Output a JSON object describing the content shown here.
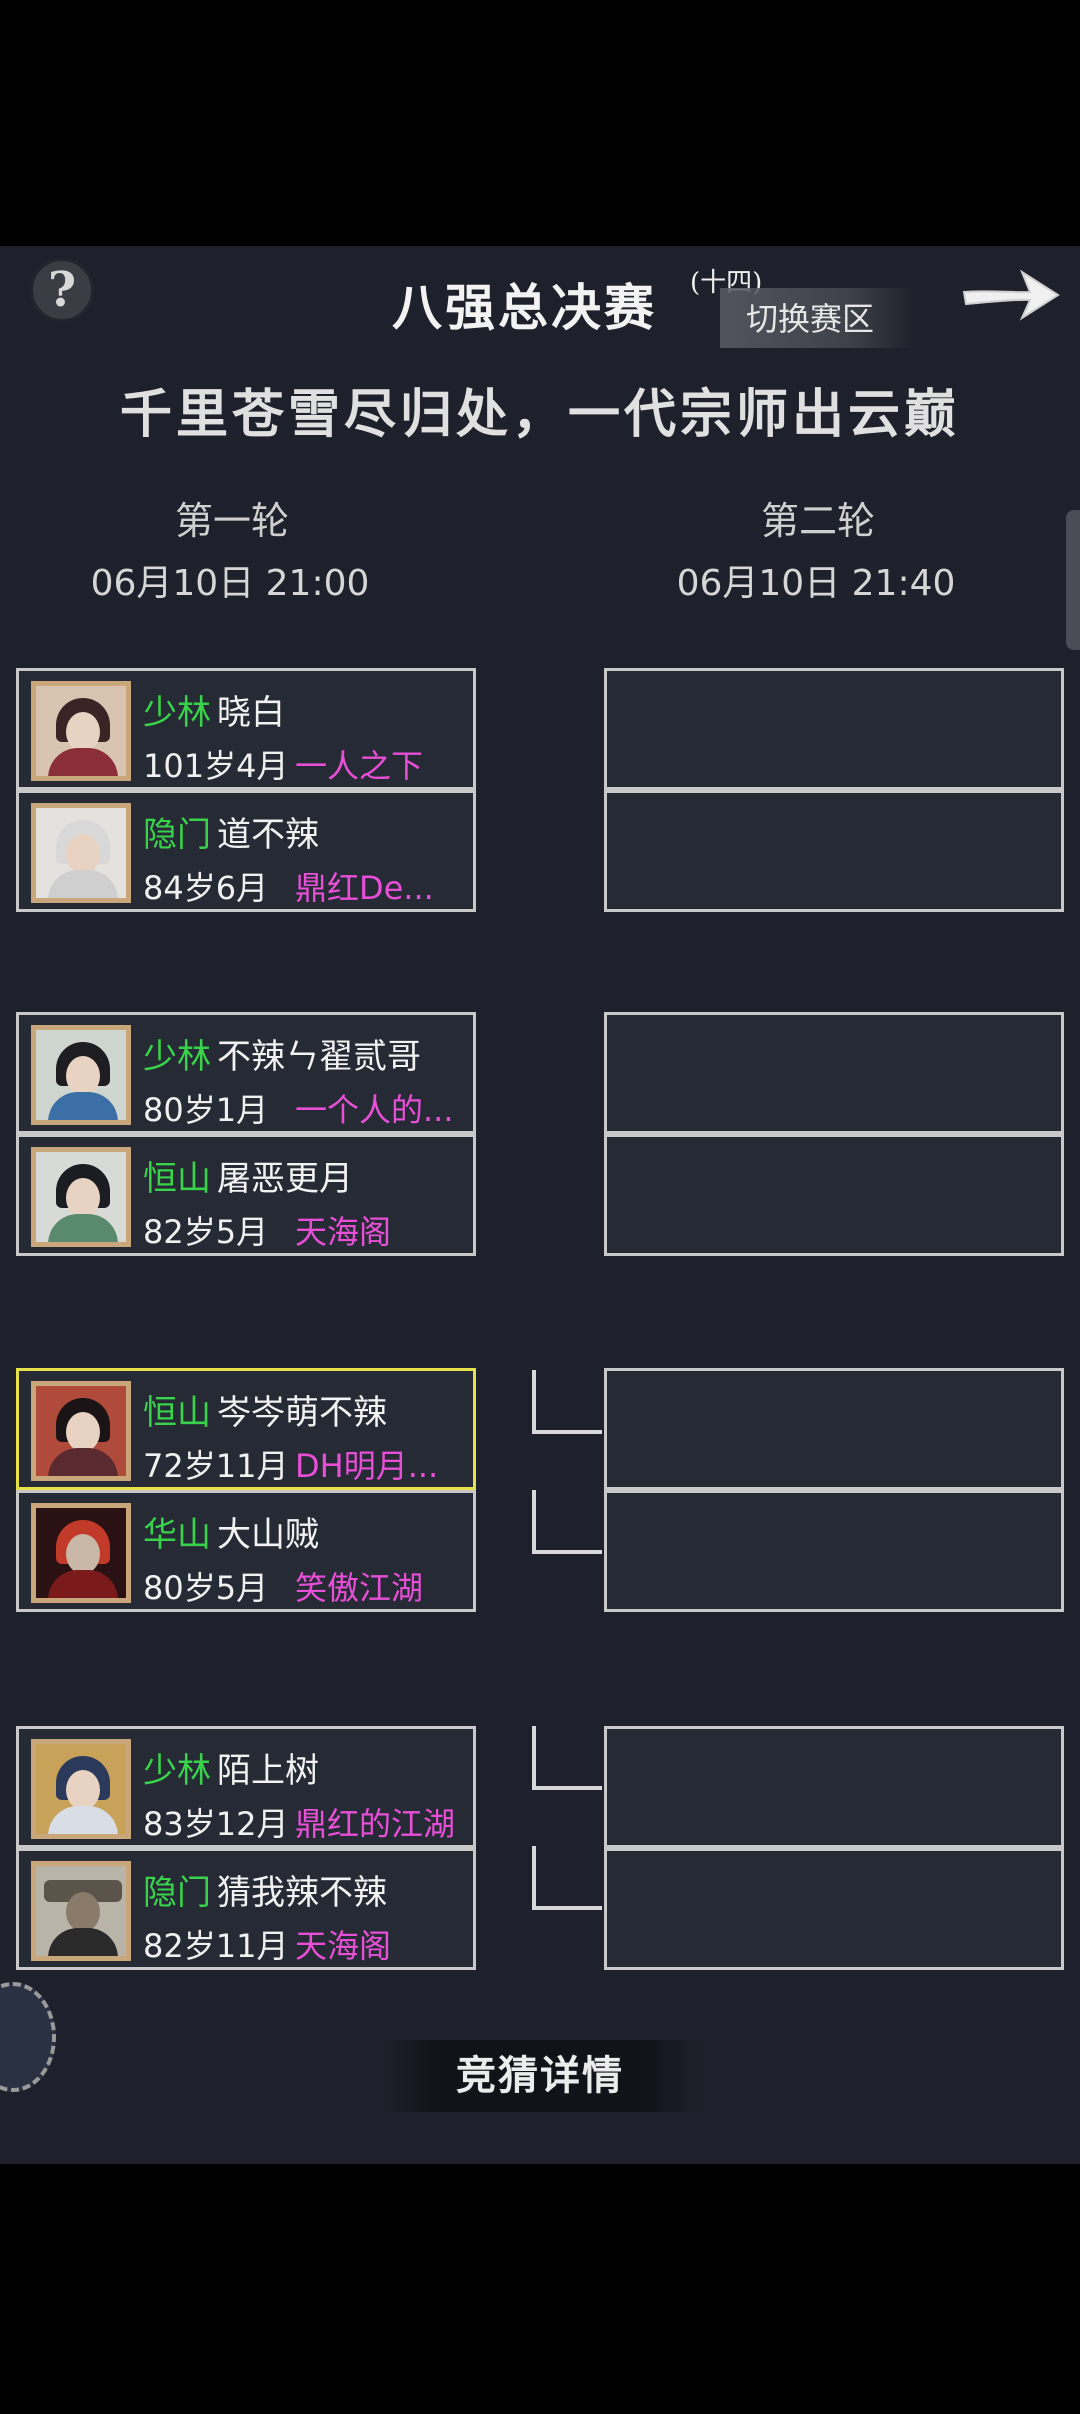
{
  "header": {
    "title": "八强总决赛",
    "title_suffix": "(十四)",
    "switch_label": "切换赛区"
  },
  "slogan": "千里苍雪尽归处，一代宗师出云巅",
  "rounds": [
    {
      "label": "第一轮",
      "time": "06月10日 21:00"
    },
    {
      "label": "第二轮",
      "time": "06月10日 21:40"
    }
  ],
  "matches": [
    {
      "players": [
        {
          "sect": "少林",
          "name": "晓白",
          "age": "101岁4月",
          "guild": "一人之下"
        },
        {
          "sect": "隐门",
          "name": "道不辣",
          "age": "84岁6月",
          "guild": "鼎红De..."
        }
      ]
    },
    {
      "players": [
        {
          "sect": "少林",
          "name": "不辣ㄣ翟贰哥",
          "age": "80岁1月",
          "guild": "一个人的..."
        },
        {
          "sect": "恒山",
          "name": "屠恶更月",
          "age": "82岁5月",
          "guild": "天海阁"
        }
      ]
    },
    {
      "players": [
        {
          "sect": "恒山",
          "name": "岑岑萌不辣",
          "age": "72岁11月",
          "guild": "DH明月..."
        },
        {
          "sect": "华山",
          "name": "大山贼",
          "age": "80岁5月",
          "guild": "笑傲江湖"
        }
      ]
    },
    {
      "players": [
        {
          "sect": "少林",
          "name": "陌上树",
          "age": "83岁12月",
          "guild": "鼎红的江湖"
        },
        {
          "sect": "隐门",
          "name": "猜我辣不辣",
          "age": "82岁11月",
          "guild": "天海阁"
        }
      ]
    }
  ],
  "guess_button": "竞猜详情",
  "colors": {
    "sect": "#38d34a",
    "guild": "#e64fd6",
    "selected_border": "#e6e04a"
  }
}
